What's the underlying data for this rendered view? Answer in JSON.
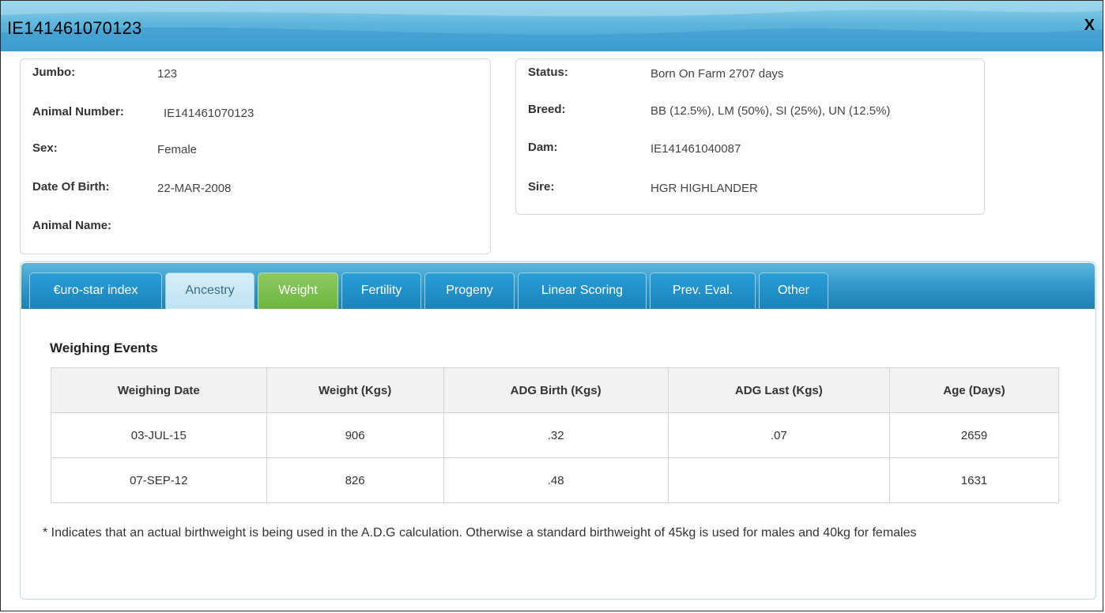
{
  "window": {
    "title": "IE141461070123",
    "close_label": "X"
  },
  "animal": {
    "fields_left": [
      {
        "label": "Jumbo:",
        "value": "123"
      },
      {
        "label": "Animal Number:",
        "value": "IE141461070123"
      },
      {
        "label": "Sex:",
        "value": "Female"
      },
      {
        "label": "Date Of Birth:",
        "value": "22-MAR-2008"
      },
      {
        "label": "Animal Name:",
        "value": ""
      }
    ],
    "fields_right": [
      {
        "label": "Status:",
        "value": "Born On Farm 2707 days"
      },
      {
        "label": "Breed:",
        "value": "BB (12.5%), LM (50%), SI (25%), UN (12.5%)"
      },
      {
        "label": "Dam:",
        "value": "IE141461040087"
      },
      {
        "label": "Sire:",
        "value": "HGR HIGHLANDER"
      }
    ]
  },
  "tabs": [
    {
      "label": "€uro-star index"
    },
    {
      "label": "Ancestry"
    },
    {
      "label": "Weight"
    },
    {
      "label": "Fertility"
    },
    {
      "label": "Progeny"
    },
    {
      "label": "Linear Scoring"
    },
    {
      "label": "Prev. Eval."
    },
    {
      "label": "Other"
    }
  ],
  "active_tab": "Weight",
  "weighing": {
    "title": "Weighing Events",
    "columns": [
      "Weighing Date",
      "Weight (Kgs)",
      "ADG Birth (Kgs)",
      "ADG Last (Kgs)",
      "Age (Days)"
    ],
    "rows": [
      [
        "03-JUL-15",
        "906",
        ".32",
        ".07",
        "2659"
      ],
      [
        "07-SEP-12",
        "826",
        ".48",
        "",
        "1631"
      ]
    ],
    "footnote": "* Indicates that an actual birthweight is being used in the A.D.G calculation. Otherwise a standard birthweight of 45kg is used for males and 40kg for females"
  },
  "colors": {
    "title_bar": "#5fb6dd",
    "tab_bar": "#2f96c7",
    "active_tab": "#6db53f",
    "hover_tab": "#bfe3f4"
  }
}
